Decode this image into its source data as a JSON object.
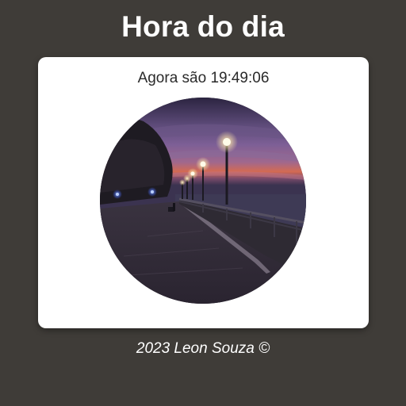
{
  "header": {
    "title": "Hora do dia"
  },
  "card": {
    "time_text": "Agora são 19:49:06",
    "image": {
      "icon": "night-waterfront-promenade-photo"
    }
  },
  "footer": {
    "text": "2023 Leon Souza ©"
  },
  "colors": {
    "page_background": "#3f3c38",
    "card_background": "#ffffff",
    "title_color": "#ffffff",
    "time_text_color": "#2a2a2a",
    "footer_color": "#ffffff"
  }
}
